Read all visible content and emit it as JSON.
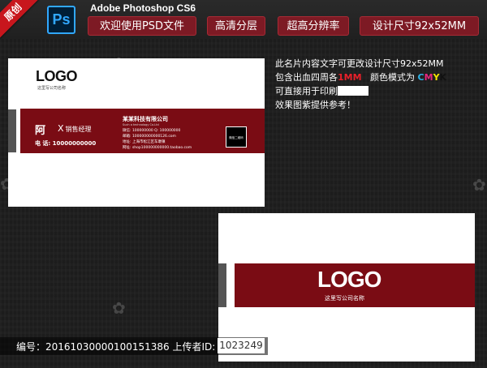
{
  "banner": {
    "ribbon": "原创",
    "app_icon": "Ps",
    "app_name": "Adobe Photoshop CS6",
    "tags": [
      "欢迎使用PSD文件",
      "高清分层",
      "超高分辨率",
      "设计尺寸92x52MM"
    ]
  },
  "card_front": {
    "logo": "LOGO",
    "logo_sub": "这里写公司名称",
    "name": "阿",
    "title_initial": "X",
    "title": "销售经理",
    "phone": "电  话: 10000000000",
    "company": "某某科技有限公司",
    "company_en": "Such a technology Co.Ltd",
    "contact_lines": [
      "微信: 100000000          Q: 100000000",
      "邮箱: 100000000000126.com",
      "地址: 上海市松江区车墩镇",
      "网址: shop100000000000.taobao.com"
    ],
    "qr_label": "微信二维码"
  },
  "description": {
    "line1": "此名片内容文字可更改设计尺寸92x52MM",
    "line2_pre": "包含出血四周各",
    "line2_bleed": "1MM",
    "line2_mid": "   颜色模式为 ",
    "cmyk": [
      "C",
      "M",
      "Y",
      "K"
    ],
    "line3": "可直接用于印刷",
    "line4": "效果图紫提供参考！"
  },
  "card_back": {
    "logo": "LOGO",
    "logo_sub": "这里写公司名称"
  },
  "footer": {
    "id_text": "编号：20161030000100151386 上传者ID:",
    "uploader_id": "1023249"
  },
  "colors": {
    "brand_red": "#7a0c14",
    "tag_bg": "#7d1a24",
    "ribbon": "#c8161d",
    "ps_blue": "#31a8ff"
  }
}
